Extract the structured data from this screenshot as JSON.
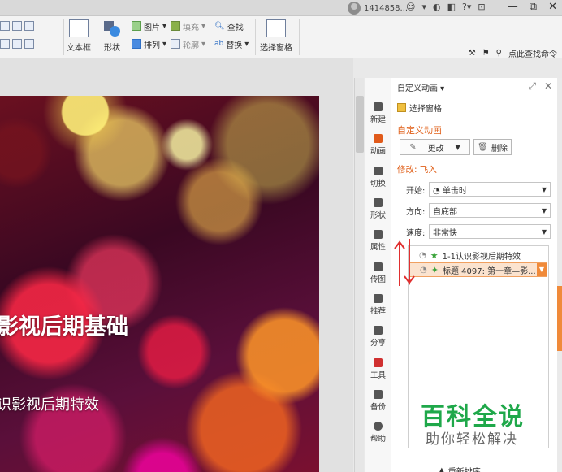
{
  "titlebar": {
    "user_id": "1414858...",
    "icons": [
      "smile-icon",
      "dropdown-icon",
      "refresh-icon",
      "skin-icon",
      "help-icon",
      "pin-icon"
    ],
    "win_minimize": "—",
    "win_restore": "⧉",
    "win_close": "✕"
  },
  "ribbon": {
    "row1_left": [
      "",
      "",
      ""
    ],
    "textbox_label": "文本框",
    "shape_label": "形状",
    "picture_label": "图片",
    "arrange_label": "排列",
    "fill_label": "填充",
    "outline_label": "轮廓",
    "find_label": "查找",
    "replace_label": "替换",
    "select_pane_label": "选择窗格",
    "search_cmd": "点此查找命令"
  },
  "slide": {
    "title": "影视后期基础",
    "subtitle": "识影视后期特效"
  },
  "sidebar": {
    "items": [
      {
        "label": "新建",
        "icon": "new-icon"
      },
      {
        "label": "动画",
        "icon": "animation-icon"
      },
      {
        "label": "切换",
        "icon": "transition-icon"
      },
      {
        "label": "形状",
        "icon": "shape-icon"
      },
      {
        "label": "属性",
        "icon": "properties-icon"
      },
      {
        "label": "传图",
        "icon": "upload-image-icon"
      },
      {
        "label": "推荐",
        "icon": "recommend-icon"
      },
      {
        "label": "分享",
        "icon": "share-icon"
      },
      {
        "label": "工具",
        "icon": "tools-icon"
      },
      {
        "label": "备份",
        "icon": "backup-icon"
      },
      {
        "label": "帮助",
        "icon": "help-icon"
      }
    ]
  },
  "panel": {
    "header": "自定义动画 ▾",
    "select_pane": "选择窗格",
    "section_title": "自定义动画",
    "change_btn": "更改",
    "delete_btn": "删除",
    "modify_label": "修改: 飞入",
    "start_label": "开始:",
    "start_value": "单击时",
    "direction_label": "方向:",
    "direction_value": "自底部",
    "speed_label": "速度:",
    "speed_value": "非常快",
    "anim_items": [
      {
        "text": "1-1认识影视后期特效"
      },
      {
        "text": "标题 4097: 第一章—影..."
      }
    ],
    "reorder_label": "重新排序"
  },
  "watermark": {
    "title": "百科全说",
    "subtitle": "助你轻松解决"
  },
  "colors": {
    "accent": "#e0601a",
    "watermark_green": "#1fa84a",
    "selected_item_bg": "#fbe3cf"
  }
}
